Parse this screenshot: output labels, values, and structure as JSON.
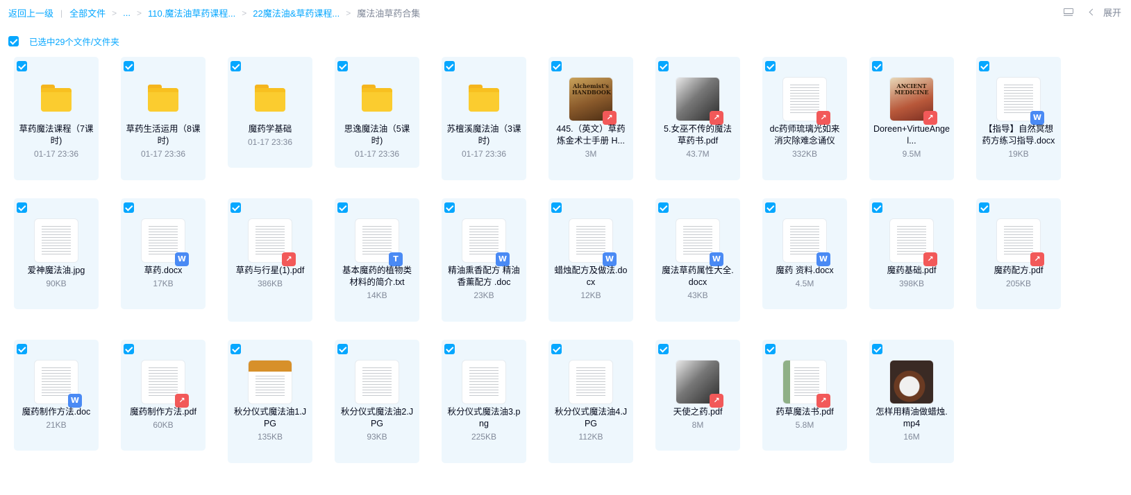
{
  "breadcrumb": {
    "back": "返回上一级",
    "all_files": "全部文件",
    "ellipsis": "...",
    "path1": "110.魔法油草药课程...",
    "path2": "22魔法油&草药课程...",
    "current": "魔法油草药合集",
    "separator": ">",
    "divider": "|"
  },
  "toolbar": {
    "expand_label": "展开"
  },
  "selection": {
    "label": "已选中29个文件/文件夹"
  },
  "items": [
    {
      "name": "草药魔法课程（7课时)",
      "meta": "01-17 23:36",
      "type": "folder"
    },
    {
      "name": "草药生活运用（8课时)",
      "meta": "01-17 23:36",
      "type": "folder"
    },
    {
      "name": "魔药学基础",
      "meta": "01-17 23:36",
      "type": "folder"
    },
    {
      "name": "思逸魔法油（5课时)",
      "meta": "01-17 23:36",
      "type": "folder"
    },
    {
      "name": "苏檀溪魔法油（3课时)",
      "meta": "01-17 23:36",
      "type": "folder"
    },
    {
      "name": "445.（英文）草药炼金术士手册 H...",
      "meta": "3M",
      "type": "pdf",
      "preview": "photo-brown",
      "cover": "Alchemist's HANDBOOK"
    },
    {
      "name": "5.女巫不传的魔法草药书.pdf",
      "meta": "43.7M",
      "type": "pdf",
      "preview": "photo-bw"
    },
    {
      "name": "dc药师琉璃光如来消灾除难念诵仪",
      "meta": "332KB",
      "type": "pdf",
      "preview": "lines"
    },
    {
      "name": "Doreen+VirtueAngel...",
      "meta": "9.5M",
      "type": "pdf",
      "preview": "photo-ancient",
      "cover": "ANCIENT MEDICINE"
    },
    {
      "name": "【指导】自然冥想药方练习指导.docx",
      "meta": "19KB",
      "type": "word",
      "preview": "lines"
    },
    {
      "name": "爱神魔法油.jpg",
      "meta": "90KB",
      "type": "image",
      "preview": "lines"
    },
    {
      "name": "草药.docx",
      "meta": "17KB",
      "type": "word",
      "preview": "lines"
    },
    {
      "name": "草药与行星(1).pdf",
      "meta": "386KB",
      "type": "pdf",
      "preview": "lines"
    },
    {
      "name": "基本魔药的植物类材料的简介.txt",
      "meta": "14KB",
      "type": "txt",
      "preview": "lines"
    },
    {
      "name": "精油熏香配方 精油香薰配方 .doc",
      "meta": "23KB",
      "type": "word",
      "preview": "lines"
    },
    {
      "name": "蜡烛配方及做法.docx",
      "meta": "12KB",
      "type": "word",
      "preview": "lines"
    },
    {
      "name": "魔法草药属性大全.docx",
      "meta": "43KB",
      "type": "word",
      "preview": "lines"
    },
    {
      "name": "魔药 资料.docx",
      "meta": "4.5M",
      "type": "word",
      "preview": "lines"
    },
    {
      "name": "魔药基础.pdf",
      "meta": "398KB",
      "type": "pdf",
      "preview": "lines"
    },
    {
      "name": "魔药配方.pdf",
      "meta": "205KB",
      "type": "pdf",
      "preview": "lines"
    },
    {
      "name": "魔药制作方法.doc",
      "meta": "21KB",
      "type": "word",
      "preview": "lines"
    },
    {
      "name": "魔药制作方法.pdf",
      "meta": "60KB",
      "type": "pdf",
      "preview": "lines"
    },
    {
      "name": "秋分仪式魔法油1.JPG",
      "meta": "135KB",
      "type": "image",
      "preview": "photo-sun"
    },
    {
      "name": "秋分仪式魔法油2.JPG",
      "meta": "93KB",
      "type": "image",
      "preview": "lines"
    },
    {
      "name": "秋分仪式魔法油3.png",
      "meta": "225KB",
      "type": "image",
      "preview": "lines"
    },
    {
      "name": "秋分仪式魔法油4.JPG",
      "meta": "112KB",
      "type": "image",
      "preview": "lines"
    },
    {
      "name": "天使之药.pdf",
      "meta": "8M",
      "type": "pdf",
      "preview": "photo-bw"
    },
    {
      "name": "药草魔法书.pdf",
      "meta": "5.8M",
      "type": "pdf",
      "preview": "photo-herb"
    },
    {
      "name": "怎样用精油做蜡烛.mp4",
      "meta": "16M",
      "type": "video",
      "preview": "photo-cup"
    }
  ],
  "badges": {
    "pdf": "↗",
    "word": "W",
    "txt": "T"
  }
}
